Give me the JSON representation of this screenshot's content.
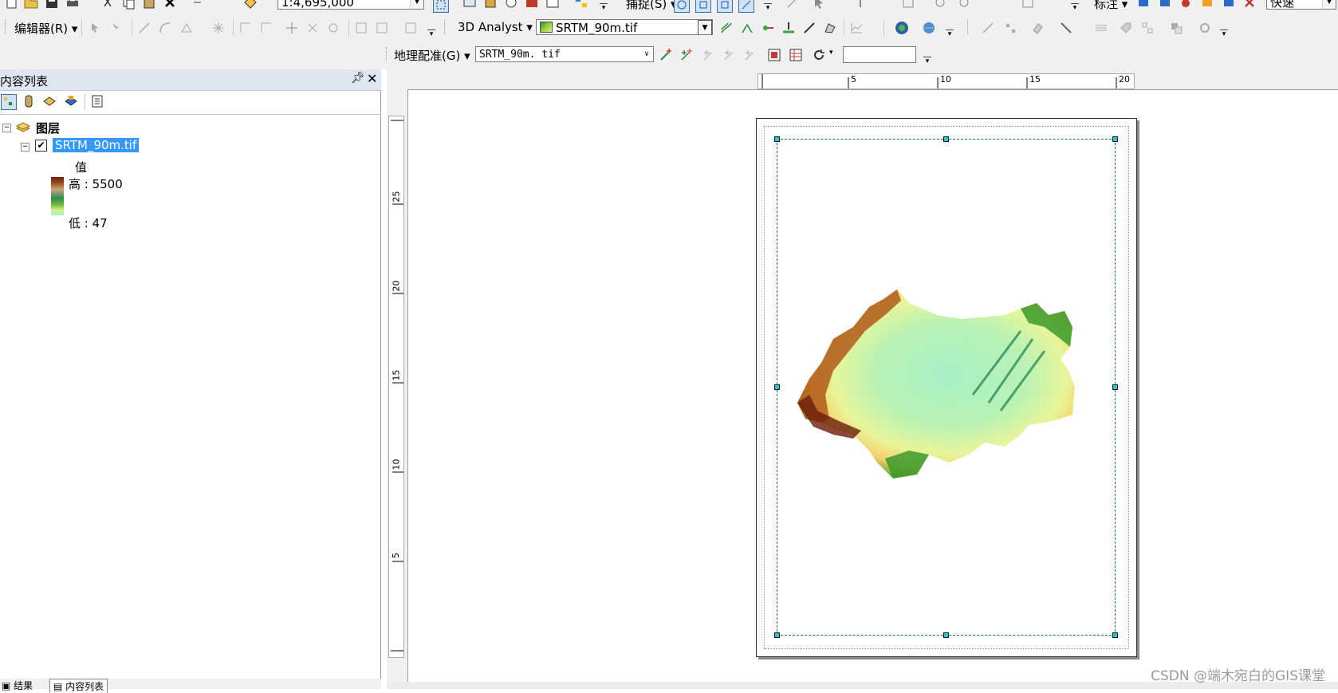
{
  "toolbar_row1": {
    "scale_value": "1:4,695,000",
    "snapping_label": "捕捉(S)",
    "label_menu": "标注",
    "quick_label": "快速"
  },
  "toolbar_row2": {
    "editor_menu": "编辑器(R)",
    "analyst_menu": "3D Analyst",
    "analyst_layer": "SRTM_90m.tif"
  },
  "toolbar_row3": {
    "georef_menu": "地理配准(G)",
    "georef_layer": "SRTM_90m. tif",
    "georef_input": ""
  },
  "toc": {
    "title": "内容列表",
    "pin_icon": "pin-icon",
    "close_icon": "close-icon",
    "root_layer": "图层",
    "layer_name": "SRTM_90m.tif",
    "legend_header": "值",
    "legend_high": "高 : 5500",
    "legend_low": "低 : 47",
    "bottom_tab_results": "结果",
    "bottom_tab_toc": "内容列表"
  },
  "rulers": {
    "horizontal_ticks": [
      "5",
      "10",
      "15",
      "20"
    ],
    "vertical_ticks": [
      "25",
      "20",
      "15",
      "10",
      "5"
    ]
  },
  "watermark": "CSDN @端木宛白的GIS课堂",
  "colors": {
    "toc_header": "#dde6f1",
    "selection": "#3399ff",
    "handle": "#2ec6c0",
    "dem_low": "#a8f0c8",
    "dem_mid": "#e8f59a",
    "dem_high": "#6b1d0a"
  }
}
